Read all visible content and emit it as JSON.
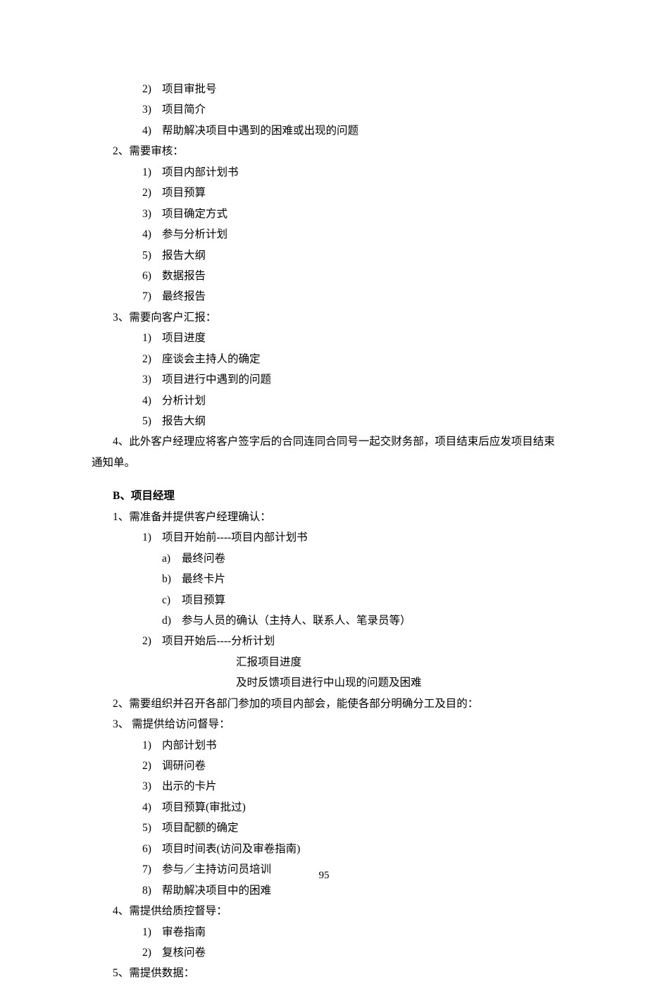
{
  "sectionA": {
    "preItems": [
      {
        "n": "2)",
        "t": "项目审批号"
      },
      {
        "n": "3)",
        "t": "项目简介"
      },
      {
        "n": "4)",
        "t": "帮助解决项目中遇到的困难或出现的问题"
      }
    ],
    "item2": {
      "label": "2、需要审核：",
      "subs": [
        {
          "n": "1)",
          "t": "项目内部计划书"
        },
        {
          "n": "2)",
          "t": "项目预算"
        },
        {
          "n": "3)",
          "t": "项目确定方式"
        },
        {
          "n": "4)",
          "t": "参与分析计划"
        },
        {
          "n": "5)",
          "t": "报告大纲"
        },
        {
          "n": "6)",
          "t": "数据报告"
        },
        {
          "n": "7)",
          "t": "最终报告"
        }
      ]
    },
    "item3": {
      "label": "3、需要向客户汇报：",
      "subs": [
        {
          "n": "1)",
          "t": "项目进度"
        },
        {
          "n": "2)",
          "t": "座谈会主持人的确定"
        },
        {
          "n": "3)",
          "t": "项目进行中遇到的问题"
        },
        {
          "n": "4)",
          "t": "分析计划"
        },
        {
          "n": "5)",
          "t": "报告大纲"
        }
      ]
    },
    "item4": "4、此外客户经理应将客户签字后的合同连同合同号一起交财务部，项目结束后应发项目结束通知单。"
  },
  "sectionB": {
    "title": "B、项目经理",
    "item1": {
      "label": "1、需准备并提供客户经理确认：",
      "sub1": {
        "n": "1)",
        "t": "项目开始前----项目内部计划书",
        "subs": [
          {
            "n": "a)",
            "t": "最终问卷"
          },
          {
            "n": "b)",
            "t": "最终卡片"
          },
          {
            "n": "c)",
            "t": "项目预算"
          },
          {
            "n": "d)",
            "t": "参与人员的确认（主持人、联系人、笔录员等）"
          }
        ]
      },
      "sub2": {
        "n": "2)",
        "t": "项目开始后----分析计划",
        "cont": [
          "汇报项目进度",
          "及时反馈项目进行中山现的问题及困难"
        ]
      }
    },
    "item2": "2、需要组织并召开各部门参加的项目内部会，能使各部分明确分工及目的：",
    "item3": {
      "label": "3、 需提供给访问督导：",
      "subs": [
        {
          "n": "1)",
          "t": "内部计划书"
        },
        {
          "n": "2)",
          "t": "调研问卷"
        },
        {
          "n": "3)",
          "t": "出示的卡片"
        },
        {
          "n": "4)",
          "t": "项目预算(审批过)"
        },
        {
          "n": "5)",
          "t": "项目配额的确定"
        },
        {
          "n": "6)",
          "t": "项目时间表(访问及审卷指南)"
        },
        {
          "n": "7)",
          "t": "参与／主持访问员培训"
        },
        {
          "n": "8)",
          "t": "帮助解决项目中的困难"
        }
      ]
    },
    "item4": {
      "label": "4、需提供给质控督导：",
      "subs": [
        {
          "n": "1)",
          "t": "审卷指南"
        },
        {
          "n": "2)",
          "t": "复核问卷"
        }
      ]
    },
    "item5": "5、需提供数据："
  },
  "pageNumber": "95"
}
